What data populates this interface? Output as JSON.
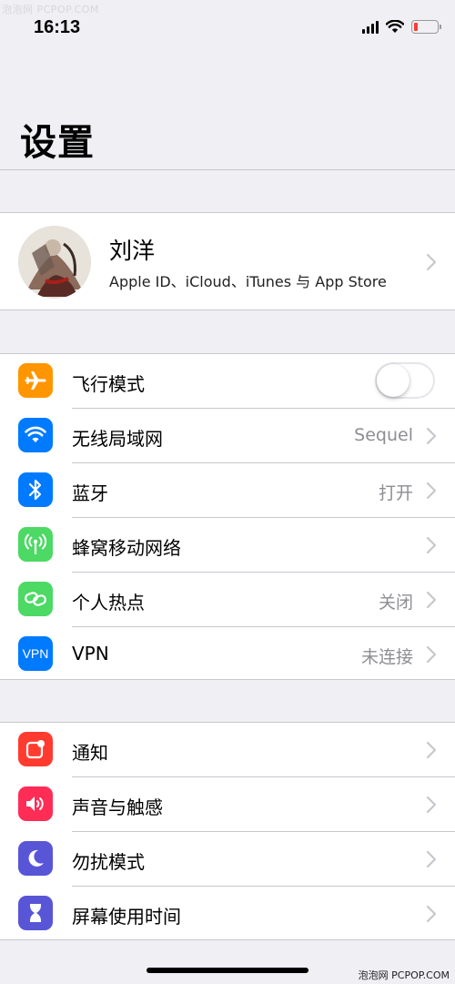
{
  "watermark_top": "泡泡网 PCPOP.COM",
  "watermark_bottom": "泡泡网 PCPOP.COM",
  "status_bar": {
    "time": "16:13",
    "battery_level": 0.15,
    "battery_color": "#ff3b30"
  },
  "page_title": "设置",
  "profile": {
    "name": "刘洋",
    "subtitle": "Apple ID、iCloud、iTunes 与 App Store"
  },
  "group1": [
    {
      "label": "飞行模式",
      "icon": "airplane-icon",
      "icon_color": "#ff9500",
      "toggle_on": false
    },
    {
      "label": "无线局域网",
      "icon": "wifi-icon",
      "icon_color": "#007aff",
      "value": "Sequel"
    },
    {
      "label": "蓝牙",
      "icon": "bluetooth-icon",
      "icon_color": "#007aff",
      "value": "打开"
    },
    {
      "label": "蜂窝移动网络",
      "icon": "cellular-icon",
      "icon_color": "#4cd964",
      "value": ""
    },
    {
      "label": "个人热点",
      "icon": "hotspot-icon",
      "icon_color": "#4cd964",
      "value": "关闭"
    },
    {
      "label": "VPN",
      "icon": "vpn-icon",
      "icon_text": "VPN",
      "icon_color": "#007aff",
      "value": "未连接"
    }
  ],
  "group2": [
    {
      "label": "通知",
      "icon": "notifications-icon",
      "icon_color": "#ff3b30"
    },
    {
      "label": "声音与触感",
      "icon": "sound-icon",
      "icon_color": "#ff2d55"
    },
    {
      "label": "勿扰模式",
      "icon": "moon-icon",
      "icon_color": "#5856d6"
    },
    {
      "label": "屏幕使用时间",
      "icon": "hourglass-icon",
      "icon_color": "#5856d6"
    }
  ]
}
